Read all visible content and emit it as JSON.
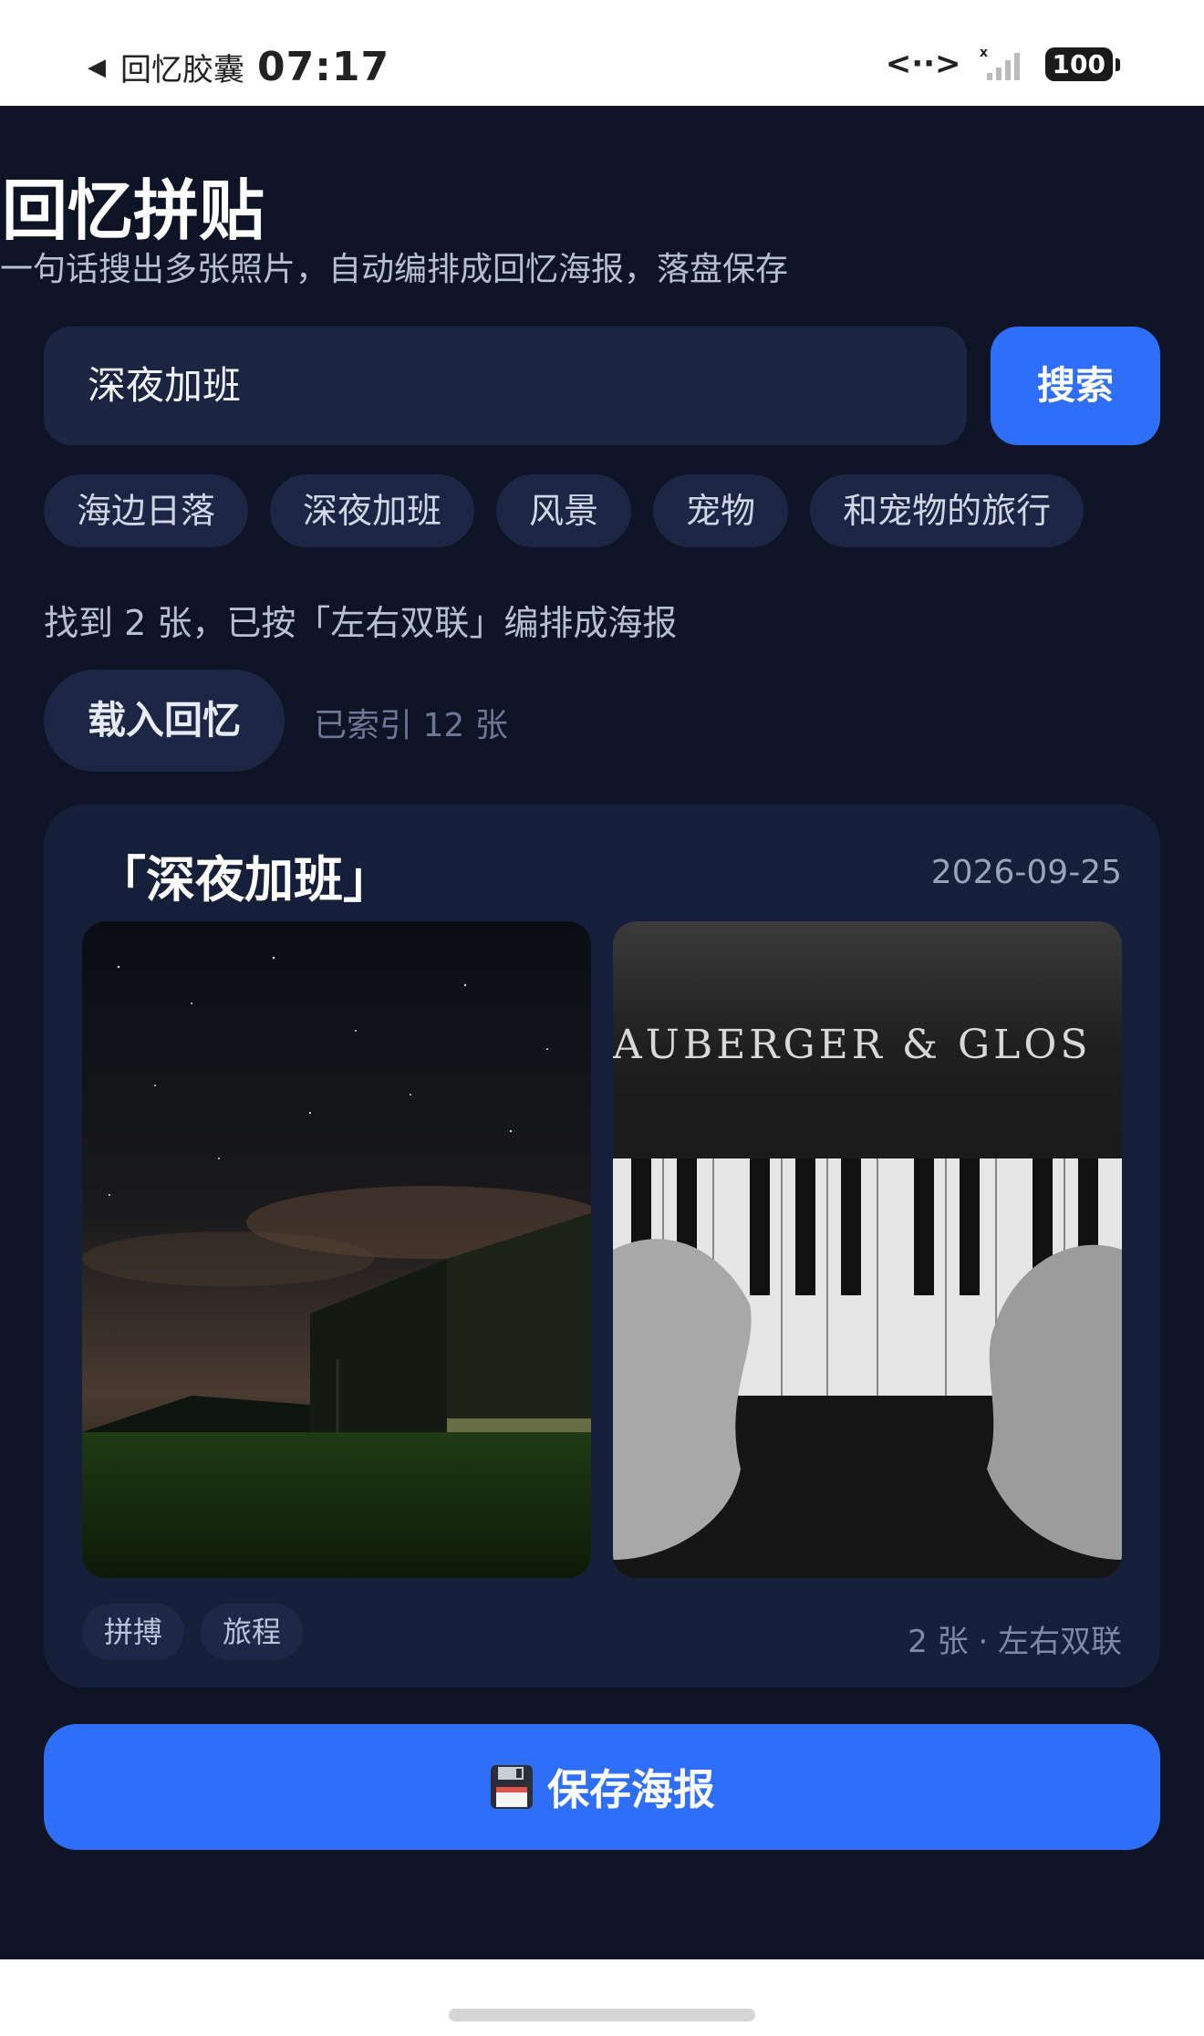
{
  "status_bar": {
    "back_icon": "back-triangle-icon",
    "app_name": "回忆胶囊",
    "time": "07:17",
    "data_icon": "data-transfer-icon",
    "battery": "100"
  },
  "header": {
    "title": "回忆拼贴",
    "subtitle": "一句话搜出多张照片，自动编排成回忆海报，落盘保存"
  },
  "search": {
    "value": "深夜加班",
    "button_label": "搜索"
  },
  "chips": [
    "海边日落",
    "深夜加班",
    "风景",
    "宠物",
    "和宠物的旅行"
  ],
  "result": {
    "text": "找到 2 张，已按「左右双联」编排成海报",
    "load_button": "载入回忆",
    "indexed_text": "已索引 12 张"
  },
  "poster": {
    "title": "「深夜加班」",
    "date": "2026-09-25",
    "photos": [
      {
        "name": "night-barn-photo"
      },
      {
        "name": "piano-hands-photo",
        "visible_text": "AUBERGER & GLOS"
      }
    ],
    "tags": [
      "拼搏",
      "旅程"
    ],
    "meta": "2 张 · 左右双联"
  },
  "save": {
    "icon": "floppy-disk-icon",
    "label": "保存海报"
  },
  "colors": {
    "background": "#0e1426",
    "card": "#161f3a",
    "accent": "#2f6ef8",
    "chip": "#1c2644"
  }
}
